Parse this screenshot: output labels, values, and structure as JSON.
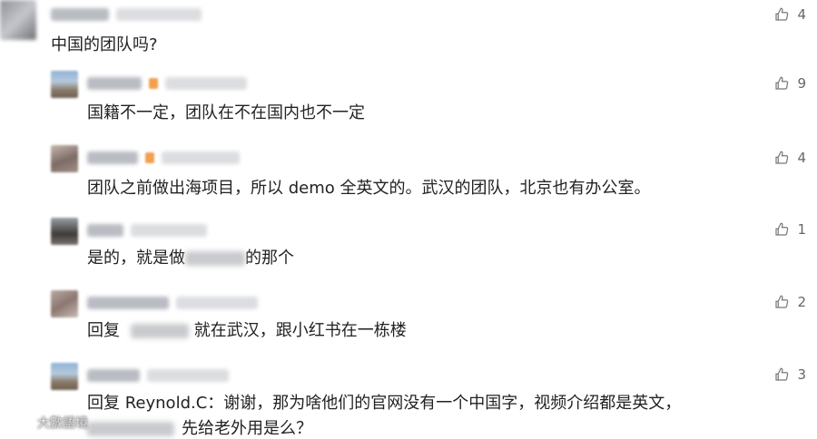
{
  "comments": [
    {
      "text": "中国的团队吗?",
      "likes": "4"
    },
    {
      "text": "国籍不一定，团队在不在国内也不一定",
      "likes": "9"
    },
    {
      "text": "团队之前做出海项目，所以 demo 全英文的。武汉的团队，北京也有办公室。",
      "likes": "4"
    },
    {
      "text_before": "是的，就是做",
      "text_after": "的那个",
      "likes": "1"
    },
    {
      "text_before": "回复",
      "text_after": "就在武汉，跟小红书在一栋楼",
      "likes": "2"
    },
    {
      "text_line1": "回复 Reynold.C：谢谢，那为啥他们的官网没有一个中国字，视频介绍都是英文，",
      "text_line2": "先给老外用是么？",
      "likes": "3"
    }
  ],
  "watermark": {
    "text": "大數語境"
  },
  "colors": {
    "text": "#222222",
    "meta": "#666666"
  },
  "icons": {
    "like": "thumbs-up-icon",
    "watermark": "watermark-logo-icon"
  }
}
